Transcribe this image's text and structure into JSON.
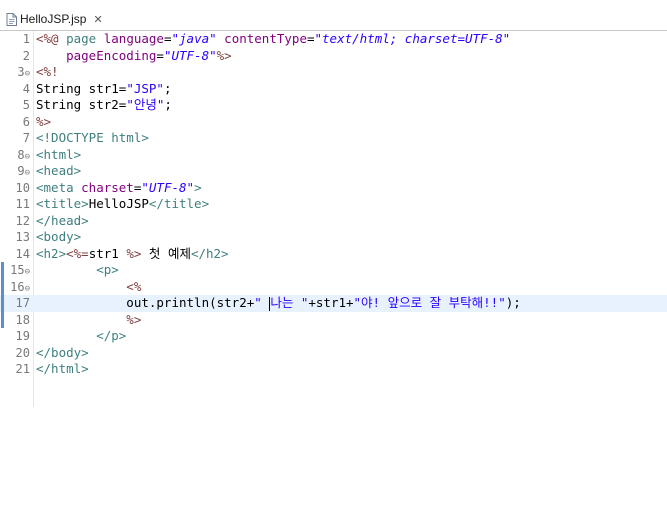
{
  "tab": {
    "file_name": "HelloJSP.jsp",
    "close_glyph": "✕"
  },
  "editor": {
    "lines": [
      {
        "n": "1",
        "fold": "",
        "segments": [
          {
            "t": "<%@ ",
            "c": "jsp"
          },
          {
            "t": "page ",
            "c": "tag"
          },
          {
            "t": "language",
            "c": "attr"
          },
          {
            "t": "=",
            "c": ""
          },
          {
            "t": "\"java\"",
            "c": "str"
          },
          {
            "t": " contentType",
            "c": "attr"
          },
          {
            "t": "=",
            "c": ""
          },
          {
            "t": "\"text/html; charset=UTF-8\"",
            "c": "str"
          }
        ]
      },
      {
        "n": "2",
        "fold": "",
        "segments": [
          {
            "t": "    pageEncoding",
            "c": "attr"
          },
          {
            "t": "=",
            "c": ""
          },
          {
            "t": "\"UTF-8\"",
            "c": "str"
          },
          {
            "t": "%>",
            "c": "jsp"
          }
        ]
      },
      {
        "n": "3",
        "fold": "⊖",
        "segments": [
          {
            "t": "<%!",
            "c": "jsp"
          }
        ]
      },
      {
        "n": "4",
        "fold": "",
        "segments": [
          {
            "t": "String str1=",
            "c": ""
          },
          {
            "t": "\"JSP\"",
            "c": "jstr"
          },
          {
            "t": ";",
            "c": ""
          }
        ]
      },
      {
        "n": "5",
        "fold": "",
        "segments": [
          {
            "t": "String str2=",
            "c": ""
          },
          {
            "t": "\"안녕\"",
            "c": "jstr"
          },
          {
            "t": ";",
            "c": ""
          }
        ]
      },
      {
        "n": "6",
        "fold": "",
        "segments": [
          {
            "t": "%>",
            "c": "jsp"
          }
        ]
      },
      {
        "n": "7",
        "fold": "",
        "segments": [
          {
            "t": "<!DOCTYPE html>",
            "c": "doctype"
          }
        ]
      },
      {
        "n": "8",
        "fold": "⊖",
        "segments": [
          {
            "t": "<html>",
            "c": "tag"
          }
        ]
      },
      {
        "n": "9",
        "fold": "⊖",
        "segments": [
          {
            "t": "<head>",
            "c": "tag"
          }
        ]
      },
      {
        "n": "10",
        "fold": "",
        "segments": [
          {
            "t": "<meta ",
            "c": "tag"
          },
          {
            "t": "charset",
            "c": "attr"
          },
          {
            "t": "=",
            "c": ""
          },
          {
            "t": "\"UTF-8\"",
            "c": "str"
          },
          {
            "t": ">",
            "c": "tag"
          }
        ]
      },
      {
        "n": "11",
        "fold": "",
        "segments": [
          {
            "t": "<title>",
            "c": "tag"
          },
          {
            "t": "HelloJSP",
            "c": ""
          },
          {
            "t": "</title>",
            "c": "tag"
          }
        ]
      },
      {
        "n": "12",
        "fold": "",
        "segments": [
          {
            "t": "</head>",
            "c": "tag"
          }
        ]
      },
      {
        "n": "13",
        "fold": "",
        "segments": [
          {
            "t": "<body>",
            "c": "tag"
          }
        ]
      },
      {
        "n": "14",
        "fold": "",
        "segments": [
          {
            "t": "<h2>",
            "c": "tag"
          },
          {
            "t": "<%=",
            "c": "jsp"
          },
          {
            "t": "str1 ",
            "c": ""
          },
          {
            "t": "%>",
            "c": "jsp"
          },
          {
            "t": " 첫 예제",
            "c": ""
          },
          {
            "t": "</h2>",
            "c": "tag"
          }
        ]
      },
      {
        "n": "15",
        "fold": "⊖",
        "segments": [
          {
            "t": "        <p>",
            "c": "tag"
          }
        ]
      },
      {
        "n": "16",
        "fold": "⊖",
        "segments": [
          {
            "t": "            <%",
            "c": "jsp"
          }
        ]
      },
      {
        "n": "17",
        "fold": "",
        "current": true,
        "segments": [
          {
            "t": "            out.println(str2+",
            "c": ""
          },
          {
            "t": "\" ",
            "c": "jstr"
          },
          {
            "t": "CARET",
            "c": "caret"
          },
          {
            "t": "나는 \"",
            "c": "jstr"
          },
          {
            "t": "+str1+",
            "c": ""
          },
          {
            "t": "\"야! 앞으로 잘 부탁해!!\"",
            "c": "jstr"
          },
          {
            "t": ");",
            "c": ""
          }
        ]
      },
      {
        "n": "18",
        "fold": "",
        "segments": [
          {
            "t": "            %>",
            "c": "jsp"
          }
        ]
      },
      {
        "n": "19",
        "fold": "",
        "segments": [
          {
            "t": "        </p>",
            "c": "tag"
          }
        ]
      },
      {
        "n": "20",
        "fold": "",
        "segments": [
          {
            "t": "</body>",
            "c": "tag"
          }
        ]
      },
      {
        "n": "21",
        "fold": "",
        "segments": [
          {
            "t": "</html>",
            "c": "tag"
          }
        ]
      }
    ]
  }
}
